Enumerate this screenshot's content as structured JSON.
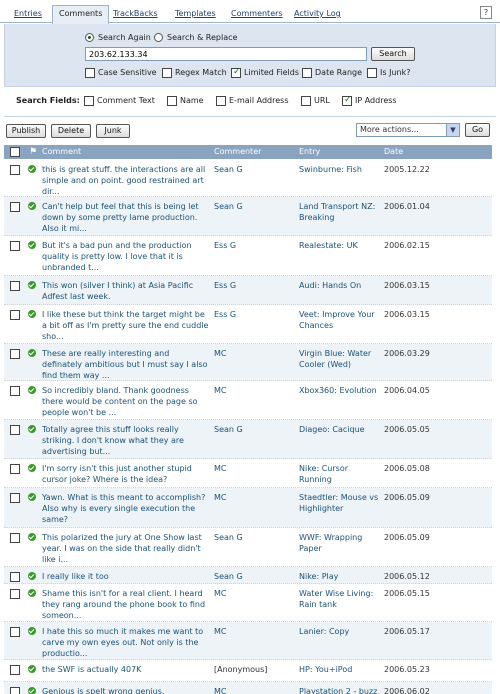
{
  "tabs": [
    {
      "label": "Entries",
      "active": false
    },
    {
      "label": "Comments",
      "active": true
    },
    {
      "label": "TrackBacks",
      "active": false
    },
    {
      "label": "Templates",
      "active": false
    },
    {
      "label": "Commenters",
      "active": false
    },
    {
      "label": "Activity Log",
      "active": false
    }
  ],
  "help_label": "?",
  "search": {
    "mode_search_again": "Search Again",
    "mode_search_replace": "Search & Replace",
    "value": "203.62.133.34",
    "button": "Search",
    "options": {
      "case_sensitive": {
        "label": "Case Sensitive",
        "checked": false
      },
      "regex_match": {
        "label": "Regex Match",
        "checked": false
      },
      "limited_fields": {
        "label": "Limited Fields",
        "checked": true
      },
      "date_range": {
        "label": "Date Range",
        "checked": false
      },
      "is_junk": {
        "label": "Is Junk?",
        "checked": false
      }
    },
    "fields_title": "Search Fields:",
    "fields": {
      "comment_text": {
        "label": "Comment Text",
        "checked": false
      },
      "name": {
        "label": "Name",
        "checked": false
      },
      "email": {
        "label": "E-mail Address",
        "checked": false
      },
      "url": {
        "label": "URL",
        "checked": false
      },
      "ip": {
        "label": "IP Address",
        "checked": true
      }
    }
  },
  "actions": {
    "publish": "Publish",
    "delete": "Delete",
    "junk": "Junk",
    "more_actions": "More actions...",
    "go": "Go"
  },
  "table": {
    "headers": {
      "comment": "Comment",
      "commenter": "Commenter",
      "entry": "Entry",
      "date": "Date"
    },
    "rows": [
      {
        "comment": "this is great stuff. the interactions are all simple and on point. good restrained art dir...",
        "commenter": "Sean G",
        "entry": "Swinburne: Fish",
        "date": "2005.12.22"
      },
      {
        "comment": "Can't help but feel that this is being let down by some pretty lame production. Also it mi...",
        "commenter": "Sean G",
        "entry": "Land Transport NZ: Breaking",
        "date": "2006.01.04"
      },
      {
        "comment": "But it's a bad pun and the production quality is pretty low. I love that it is unbranded t...",
        "commenter": "Ess G",
        "entry": "Realestate: UK",
        "date": "2006.02.15"
      },
      {
        "comment": "This won (silver I think) at Asia Pacific Adfest last week.",
        "commenter": "Ess G",
        "entry": "Audi: Hands On",
        "date": "2006.03.15"
      },
      {
        "comment": "I like these but think the target might be a bit off as I'm pretty sure the end cuddle sho...",
        "commenter": "Ess G",
        "entry": "Veet: Improve Your Chances",
        "date": "2006.03.15"
      },
      {
        "comment": "These are really interesting and definately ambitious but I must say I also find them way ...",
        "commenter": "MC",
        "entry": "Virgin Blue: Water Cooler (Wed)",
        "date": "2006.03.29"
      },
      {
        "comment": "So incredibly bland. Thank goodness there would be content on the page so people won't be ...",
        "commenter": "MC",
        "entry": "Xbox360: Evolution",
        "date": "2006.04.05"
      },
      {
        "comment": "Totally agree this stuff looks really striking. I don't know what they are advertising but...",
        "commenter": "Sean G",
        "entry": "Diageo: Cacique",
        "date": "2006.05.05"
      },
      {
        "comment": "I'm sorry isn't this just another stupid cursor joke? Where is the idea?",
        "commenter": "MC",
        "entry": "Nike: Cursor Running",
        "date": "2006.05.08"
      },
      {
        "comment": "Yawn. What is this meant to accomplish? Also why is every single execution the same?",
        "commenter": "MC",
        "entry": "Staedtler: Mouse vs Highlighter",
        "date": "2006.05.09"
      },
      {
        "comment": "This polarized the jury at One Show last year. I was on the side that really didn't like i...",
        "commenter": "Sean G",
        "entry": "WWF: Wrapping Paper",
        "date": "2006.05.09"
      },
      {
        "comment": "I really like it too",
        "commenter": "Sean G",
        "entry": "Nike: Play",
        "date": "2006.05.12"
      },
      {
        "comment": "Shame this isn't for a real client. I heard they rang around the phone book to find someon...",
        "commenter": "MC",
        "entry": "Water Wise Living: Rain tank",
        "date": "2006.05.15"
      },
      {
        "comment": "I hate this so much it makes me want to carve my own eyes out. Not only is the productio...",
        "commenter": "MC",
        "entry": "Lanier: Copy",
        "date": "2006.05.17"
      },
      {
        "comment": "the SWF is actually 407K",
        "commenter": "[Anonymous]",
        "entry": "HP: You+iPod",
        "date": "2006.05.23"
      },
      {
        "comment": "Genious is spelt wrong genius.",
        "commenter": "MC",
        "entry": "Playstation 2 - buzz",
        "date": "2006.06.02"
      }
    ]
  }
}
